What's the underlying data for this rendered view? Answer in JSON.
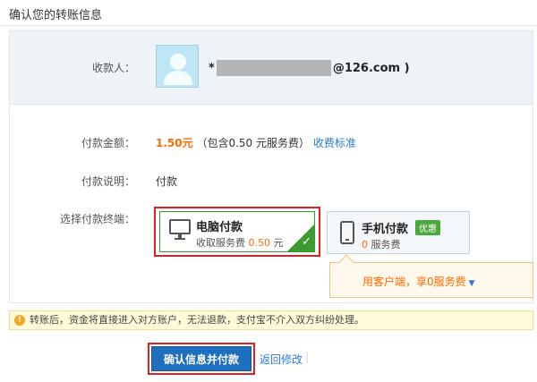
{
  "page": {
    "title": "确认您的转账信息"
  },
  "payee": {
    "label": "收款人：",
    "name_prefix": "*",
    "email_suffix": "@126.com )"
  },
  "amount": {
    "label": "付款金额：",
    "value": "1.50",
    "unit": "元",
    "fee_note": "（包含0.50 元服务费）",
    "fee_link": "收费标准"
  },
  "description": {
    "label": "付款说明：",
    "value": "付款"
  },
  "terminal": {
    "label": "选择付款终端：",
    "options": [
      {
        "title": "电脑付款",
        "fee_prefix": "收取服务费",
        "fee": "0.50",
        "fee_unit": "元",
        "selected": true
      },
      {
        "title": "手机付款",
        "badge": "优惠",
        "fee": "0",
        "fee_suffix": "服务费",
        "selected": false
      }
    ],
    "client_tip": "用客户端，享0服务费"
  },
  "warning": {
    "text": "转账后，资金将直接进入对方账户，无法退款，支付宝不介入双方纠纷处理。"
  },
  "actions": {
    "confirm_label": "确认信息并付款",
    "back_label": "返回修改"
  },
  "colors": {
    "accent": "#ff6a00",
    "link": "#2b7bd6",
    "button": "#1e6fbf",
    "highlight": "#e02020",
    "selected": "#3d9b2f"
  }
}
